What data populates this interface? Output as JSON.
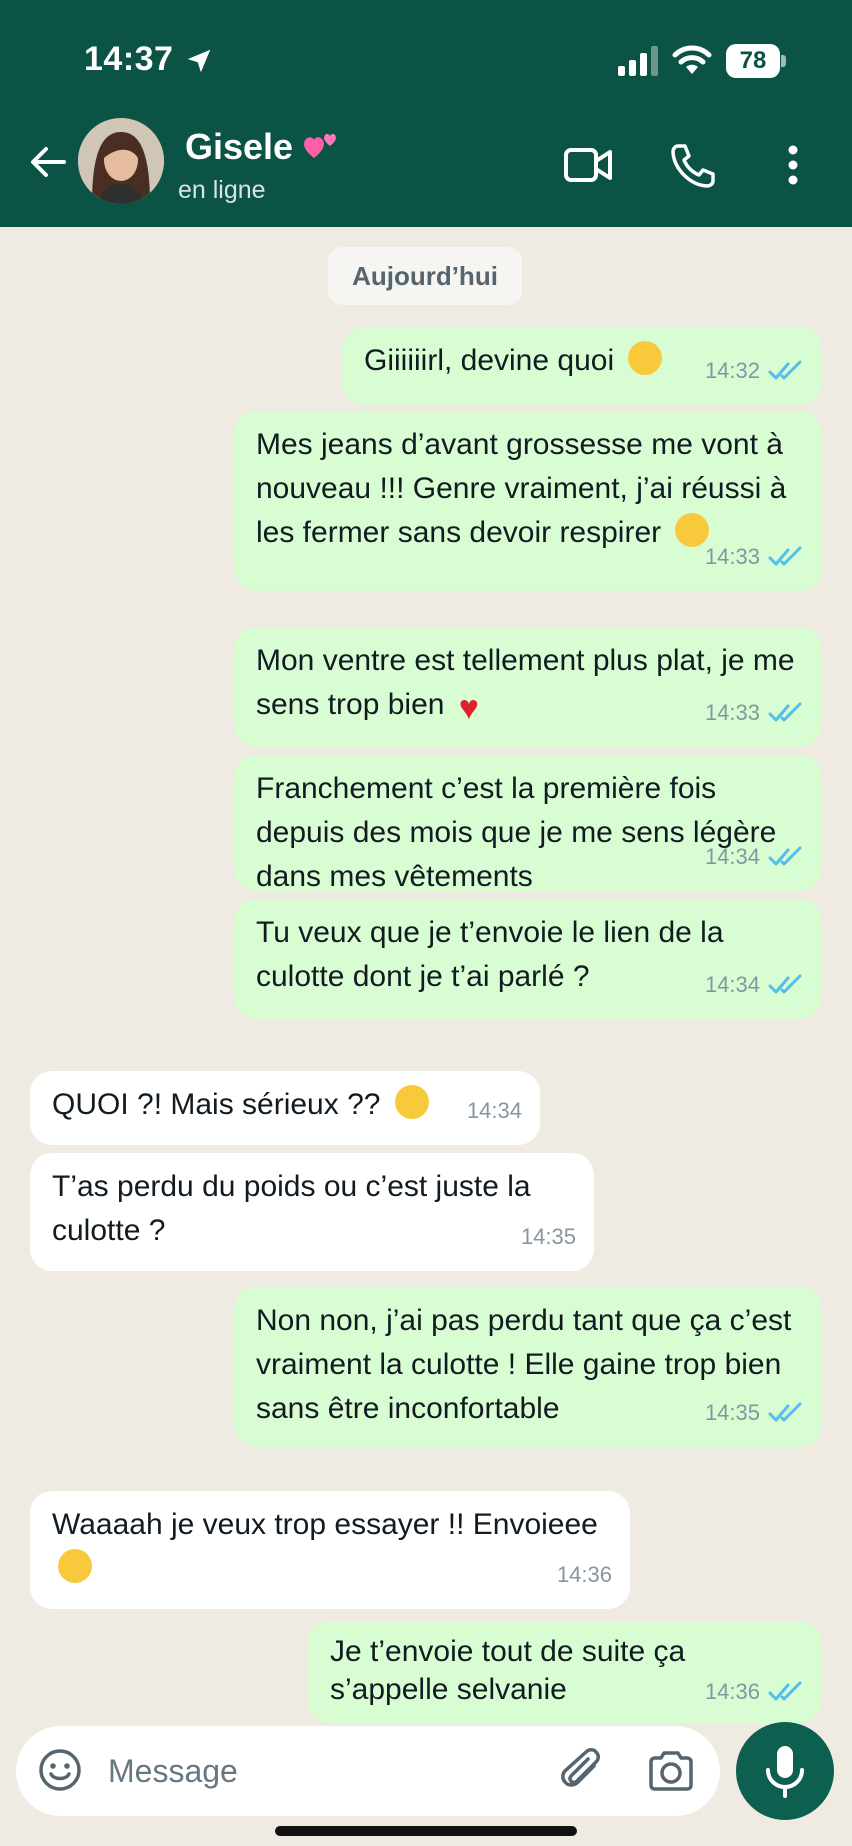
{
  "status_bar": {
    "time": "14:37",
    "battery": "78"
  },
  "header": {
    "contact_name": "Gisele",
    "contact_status": "en ligne"
  },
  "chat": {
    "date_chip": "Aujourd’hui",
    "messages": [
      {
        "dir": "out",
        "text": "Giiiiiirl, devine quoi",
        "time": "14:32"
      },
      {
        "dir": "out",
        "text": "Mes jeans d’avant grossesse me vont à nouveau !!! Genre vraiment, j’ai réussi à les fermer sans devoir respirer",
        "time": "14:33"
      },
      {
        "dir": "out",
        "text": "Mon ventre est tellement plus plat, je me sens trop bien",
        "time": "14:33"
      },
      {
        "dir": "out",
        "text": "Franchement c’est la première fois depuis des mois que je me sens légère dans mes vêtements",
        "time": "14:34"
      },
      {
        "dir": "out",
        "text": "Tu veux que je t’envoie le lien de la culotte dont je t’ai parlé ?",
        "time": "14:34"
      },
      {
        "dir": "in",
        "text": "QUOI ?! Mais sérieux ??",
        "time": "14:34"
      },
      {
        "dir": "in",
        "text": "T’as perdu du poids ou c’est juste la culotte ?",
        "time": "14:35"
      },
      {
        "dir": "out",
        "text": "Non non, j’ai pas perdu tant que ça c’est vraiment la culotte ! Elle gaine trop bien sans être inconfortable",
        "time": "14:35"
      },
      {
        "dir": "in",
        "text": "Waaaah je veux trop essayer !! Envoieee",
        "time": "14:36"
      },
      {
        "dir": "out",
        "text": "Je t’envoie tout de suite ça s’appelle selvanie",
        "time": "14:36"
      }
    ]
  },
  "input": {
    "placeholder": "Message"
  },
  "colors": {
    "header": "#0b5345",
    "outgoing": "#d9fdd3",
    "incoming": "#ffffff",
    "read_ticks": "#53bdeb"
  },
  "icons": {
    "back": "arrow-left-icon",
    "video": "video-call-icon",
    "call": "phone-icon",
    "menu": "more-vertical-icon",
    "emoji": "emoji-icon",
    "attach": "paperclip-icon",
    "camera": "camera-icon",
    "mic": "microphone-icon"
  }
}
